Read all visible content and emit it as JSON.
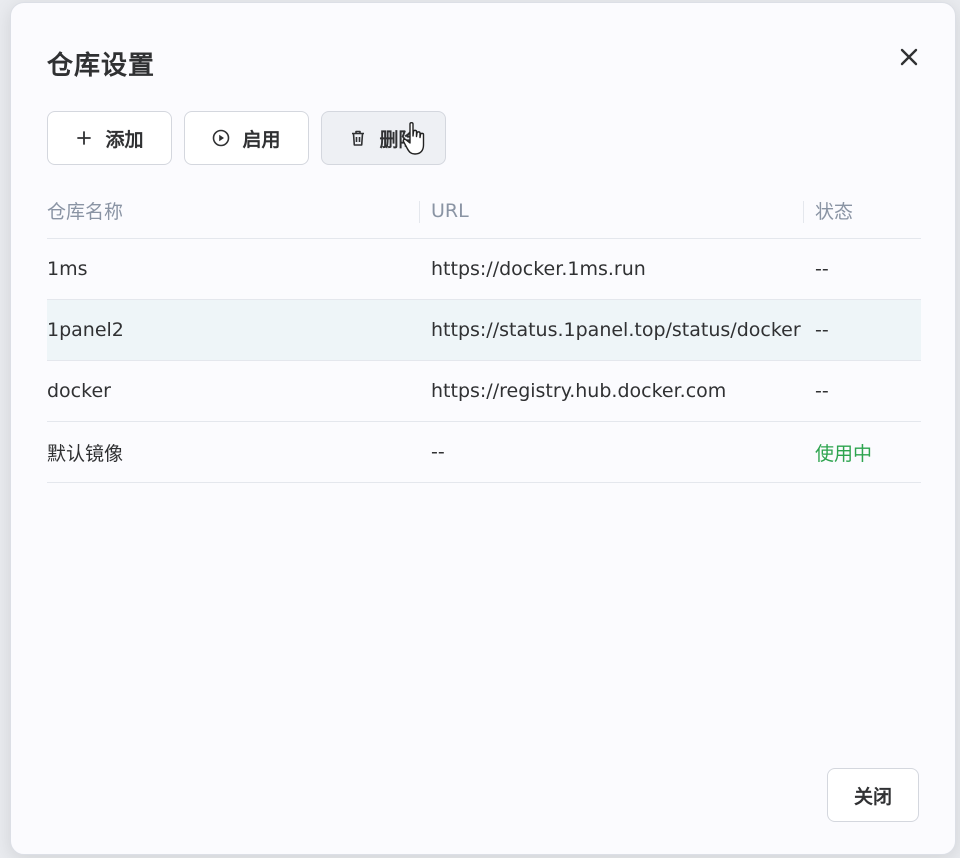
{
  "dialog": {
    "title": "仓库设置",
    "close_icon": "close-icon"
  },
  "toolbar": {
    "add_label": "添加",
    "add_icon": "plus-icon",
    "enable_label": "启用",
    "enable_icon": "play-circle-icon",
    "delete_label": "删除",
    "delete_icon": "trash-icon"
  },
  "table": {
    "columns": [
      "仓库名称",
      "URL",
      "状态"
    ],
    "rows": [
      {
        "name": "1ms",
        "url": "https://docker.1ms.run",
        "status": "--"
      },
      {
        "name": "1panel2",
        "url": "https://status.1panel.top/status/docker",
        "status": "--"
      },
      {
        "name": "docker",
        "url": "https://registry.hub.docker.com",
        "status": "--"
      },
      {
        "name": "默认镜像",
        "url": "--",
        "status": "使用中"
      }
    ]
  },
  "footer": {
    "close_label": "关闭"
  },
  "colors": {
    "status_active": "#2ea44f",
    "highlight_row": "#eef5f8"
  }
}
